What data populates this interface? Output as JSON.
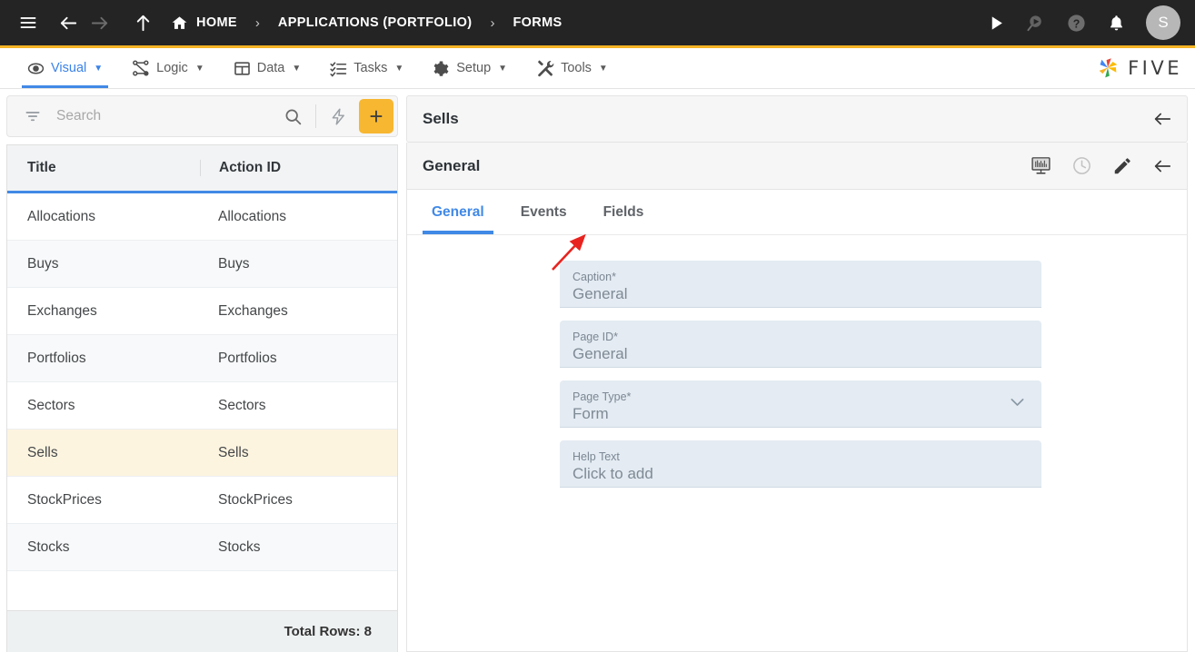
{
  "topbar": {
    "menu_icon": "hamburger-icon",
    "back_icon": "arrow-left-icon",
    "forward_icon": "arrow-right-icon",
    "up_icon": "arrow-up-icon",
    "breadcrumbs": [
      {
        "label": "HOME",
        "icon": "home-icon"
      },
      {
        "label": "APPLICATIONS (PORTFOLIO)",
        "icon": ""
      },
      {
        "label": "FORMS",
        "icon": ""
      }
    ],
    "separator": "›",
    "actions": [
      {
        "name": "run-icon",
        "title": "Run"
      },
      {
        "name": "search-debug-icon",
        "title": "Search"
      },
      {
        "name": "help-icon",
        "title": "Help"
      },
      {
        "name": "notifications-icon",
        "title": "Notifications"
      }
    ],
    "avatar_initial": "S",
    "accent_color": "#F5B324",
    "background_color": "#242424"
  },
  "menubar": {
    "items": [
      {
        "label": "Visual",
        "icon": "eye-icon",
        "active": true
      },
      {
        "label": "Logic",
        "icon": "logic-nodes-icon",
        "active": false
      },
      {
        "label": "Data",
        "icon": "table-icon",
        "active": false
      },
      {
        "label": "Tasks",
        "icon": "checklist-icon",
        "active": false
      },
      {
        "label": "Setup",
        "icon": "gear-icon",
        "active": false
      },
      {
        "label": "Tools",
        "icon": "tools-icon",
        "active": false
      }
    ],
    "caret": "▼",
    "brand_text": "FIVE",
    "active_color": "#3b82e8"
  },
  "sidebar": {
    "search": {
      "placeholder": "Search",
      "value": "",
      "filter_icon": "filter-icon",
      "search_icon": "search-icon",
      "bolt_icon": "lightning-bolt-icon",
      "add_label": "+"
    },
    "grid": {
      "columns": [
        "Title",
        "Action ID"
      ],
      "rows": [
        {
          "title": "Allocations",
          "action_id": "Allocations",
          "selected": false
        },
        {
          "title": "Buys",
          "action_id": "Buys",
          "selected": false
        },
        {
          "title": "Exchanges",
          "action_id": "Exchanges",
          "selected": false
        },
        {
          "title": "Portfolios",
          "action_id": "Portfolios",
          "selected": false
        },
        {
          "title": "Sectors",
          "action_id": "Sectors",
          "selected": false
        },
        {
          "title": "Sells",
          "action_id": "Sells",
          "selected": true
        },
        {
          "title": "StockPrices",
          "action_id": "StockPrices",
          "selected": false
        },
        {
          "title": "Stocks",
          "action_id": "Stocks",
          "selected": false
        }
      ],
      "footer": "Total Rows: 8",
      "selected_row_color": "#fdf4e0",
      "header_underline_color": "#4189e6"
    }
  },
  "detail": {
    "record_title": "Sells",
    "record_back_icon": "arrow-left-icon",
    "page_title": "General",
    "page_actions": [
      {
        "name": "display-preview-icon"
      },
      {
        "name": "history-clock-icon"
      },
      {
        "name": "edit-pencil-icon"
      },
      {
        "name": "arrow-left-icon"
      }
    ],
    "tabs": [
      {
        "label": "General",
        "active": true
      },
      {
        "label": "Events",
        "active": false
      },
      {
        "label": "Fields",
        "active": false
      }
    ],
    "fields": [
      {
        "label": "Caption",
        "required": true,
        "value": "General",
        "type": "text"
      },
      {
        "label": "Page ID",
        "required": true,
        "value": "General",
        "type": "text"
      },
      {
        "label": "Page Type",
        "required": true,
        "value": "Form",
        "type": "select"
      },
      {
        "label": "Help Text",
        "required": false,
        "value": "Click to add",
        "type": "text"
      }
    ],
    "required_marker": "*",
    "field_background": "#e4ebf2"
  },
  "annotation": {
    "arrow_color": "#e8231f",
    "points_to": "Fields"
  }
}
